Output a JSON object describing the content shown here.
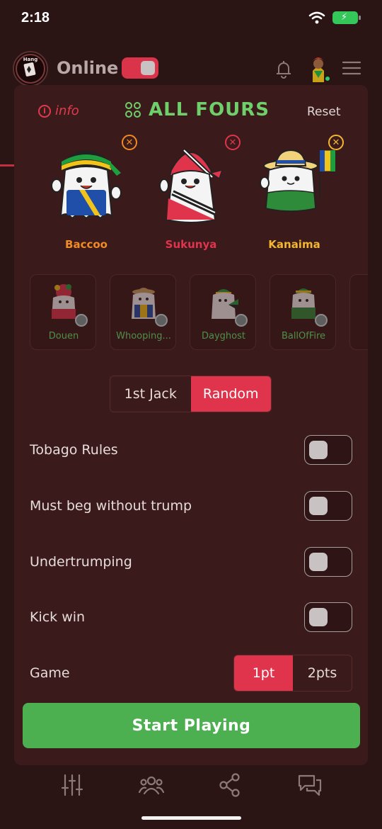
{
  "status_bar": {
    "time": "2:18"
  },
  "header": {
    "logo_text": "Hang",
    "online_label": "Online",
    "online_toggle": true
  },
  "panel": {
    "info_label": "info",
    "title": "ALL FOURS",
    "reset_label": "Reset",
    "selected_players": [
      {
        "name": "Baccoo",
        "color": "#f08a24"
      },
      {
        "name": "Sukunya",
        "color": "#e0344c"
      },
      {
        "name": "Kanaima",
        "color": "#f2b632"
      }
    ],
    "available_characters": [
      {
        "name": "Douen"
      },
      {
        "name": "Whooping..."
      },
      {
        "name": "Dayghost"
      },
      {
        "name": "BallOfFire"
      }
    ],
    "deal_mode": {
      "options": [
        "1st Jack",
        "Random"
      ],
      "selected": "Random"
    },
    "settings": [
      {
        "label": "Tobago Rules",
        "enabled": false
      },
      {
        "label": "Must beg without trump",
        "enabled": false
      },
      {
        "label": "Undertrumping",
        "enabled": false
      },
      {
        "label": "Kick win",
        "enabled": false
      }
    ],
    "game": {
      "label": "Game",
      "options": [
        "1pt",
        "2pts"
      ],
      "selected": "1pt"
    },
    "start_button": "Start Playing"
  },
  "bottom_nav": {
    "items": [
      "sliders-icon",
      "users-icon",
      "share-icon",
      "chat-icon"
    ]
  },
  "colors": {
    "accent_red": "#e0344c",
    "accent_green": "#4caf50",
    "title_green": "#6fcf6a",
    "background": "#2b1414",
    "panel": "#3a1a1a"
  }
}
